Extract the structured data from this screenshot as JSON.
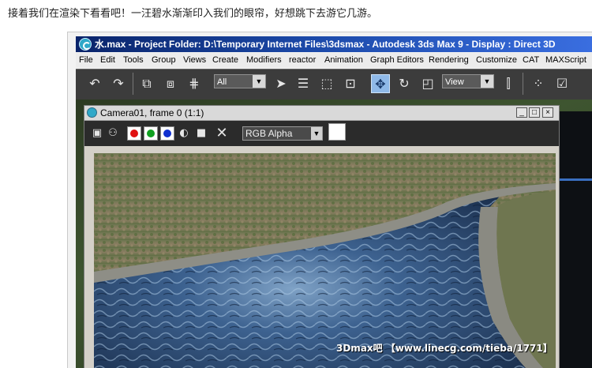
{
  "caption": "接着我们在渲染下看看吧！一汪碧水渐渐印入我们的眼帘，好想跳下去游它几游。",
  "max_window": {
    "title": "水.max    - Project Folder: D:\\Temporary Internet Files\\3dsmax    - Autodesk 3ds Max 9    - Display : Direct 3D"
  },
  "menu": {
    "items": [
      "File",
      "Edit",
      "Tools",
      "Group",
      "Views",
      "Create",
      "Modifiers",
      "reactor",
      "Animation",
      "Graph Editors",
      "Rendering",
      "Customize",
      "CAT",
      "MAXScript"
    ]
  },
  "toolbar": {
    "selection_filter": "All",
    "ref_coord": "View"
  },
  "render_window": {
    "title": "Camera01, frame 0 (1:1)",
    "channel_select": "RGB Alpha",
    "swatch_colors": {
      "red": "#e01010",
      "green": "#10a020",
      "blue": "#1030d0"
    }
  },
  "watermark": "3Dmax吧 【www.linecg.com/tieba/1771】"
}
